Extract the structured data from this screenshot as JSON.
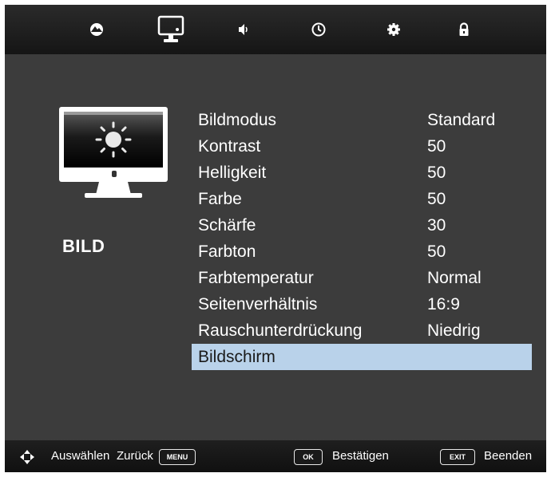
{
  "tabs": [
    {
      "icon": "picture-globe-icon",
      "selected": false
    },
    {
      "icon": "monitor-icon",
      "selected": true
    },
    {
      "icon": "speaker-icon",
      "selected": false
    },
    {
      "icon": "clock-icon",
      "selected": false
    },
    {
      "icon": "gear-icon",
      "selected": false
    },
    {
      "icon": "lock-icon",
      "selected": false
    }
  ],
  "section": {
    "title": "BILD",
    "icon": "monitor-brightness-icon"
  },
  "menu": {
    "items": [
      {
        "label": "Bildmodus",
        "value": "Standard"
      },
      {
        "label": "Kontrast",
        "value": "50"
      },
      {
        "label": "Helligkeit",
        "value": "50"
      },
      {
        "label": "Farbe",
        "value": "50"
      },
      {
        "label": "Schärfe",
        "value": "30"
      },
      {
        "label": "Farbton",
        "value": "50"
      },
      {
        "label": "Farbtemperatur",
        "value": "Normal"
      },
      {
        "label": "Seitenverhältnis",
        "value": "16:9"
      },
      {
        "label": "Rauschunterdrückung",
        "value": "Niedrig"
      },
      {
        "label": "Bildschirm",
        "value": ""
      }
    ],
    "selected_index": 9
  },
  "footer": {
    "select_label": "Auswählen",
    "back_label": "Zurück",
    "menu_key": "MENU",
    "ok_key": "OK",
    "confirm_label": "Bestätigen",
    "exit_key": "EXIT",
    "exit_label": "Beenden"
  },
  "colors": {
    "background": "#3c3c3c",
    "selected_row": "#b9d2ea",
    "bar": "#1e1e1e"
  }
}
